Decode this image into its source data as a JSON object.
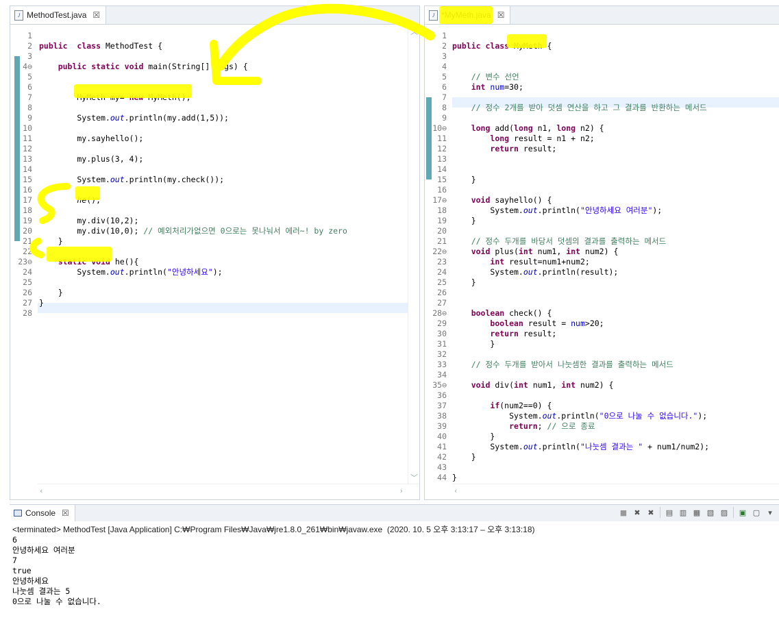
{
  "left_editor": {
    "tab_label": "MethodTest.java",
    "lines": [
      {
        "n": "1",
        "t": []
      },
      {
        "n": "2",
        "t": [
          [
            "kw",
            "public"
          ],
          [
            "",
            "  "
          ],
          [
            "kw",
            "class"
          ],
          [
            "",
            " MethodTest {"
          ]
        ]
      },
      {
        "n": "3",
        "t": []
      },
      {
        "n": "4⊖",
        "t": [
          [
            "",
            "    "
          ],
          [
            "kw",
            "public"
          ],
          [
            "",
            " "
          ],
          [
            "kw",
            "static"
          ],
          [
            "",
            " "
          ],
          [
            "kw",
            "void"
          ],
          [
            "",
            " main(String[] args) {"
          ]
        ]
      },
      {
        "n": "5",
        "t": []
      },
      {
        "n": "6",
        "t": []
      },
      {
        "n": "7",
        "t": [
          [
            "",
            "        MyMeth my= "
          ],
          [
            "kw",
            "new"
          ],
          [
            "",
            " MyMeth();"
          ]
        ]
      },
      {
        "n": "8",
        "t": []
      },
      {
        "n": "9",
        "t": [
          [
            "",
            "        System."
          ],
          [
            "fl",
            "out"
          ],
          [
            "",
            ".println(my.add(1,5));"
          ]
        ]
      },
      {
        "n": "10",
        "t": []
      },
      {
        "n": "11",
        "t": [
          [
            "",
            "        my.sayhello();"
          ]
        ]
      },
      {
        "n": "12",
        "t": []
      },
      {
        "n": "13",
        "t": [
          [
            "",
            "        my.plus(3, 4);"
          ]
        ]
      },
      {
        "n": "14",
        "t": []
      },
      {
        "n": "15",
        "t": [
          [
            "",
            "        System."
          ],
          [
            "fl",
            "out"
          ],
          [
            "",
            ".println(my.check());"
          ]
        ]
      },
      {
        "n": "16",
        "t": []
      },
      {
        "n": "17",
        "t": [
          [
            "",
            "        "
          ],
          [
            "it",
            "he"
          ],
          [
            "",
            "();"
          ]
        ]
      },
      {
        "n": "18",
        "t": []
      },
      {
        "n": "19",
        "t": [
          [
            "",
            "        my.div(10,2);"
          ]
        ]
      },
      {
        "n": "20",
        "t": [
          [
            "",
            "        my.div(10,0); "
          ],
          [
            "cm",
            "// 예외처리가없으면 0으로는 못나눠서 에러~! by zero"
          ]
        ]
      },
      {
        "n": "21",
        "t": [
          [
            "",
            "    }"
          ]
        ]
      },
      {
        "n": "22",
        "t": []
      },
      {
        "n": "23⊖",
        "t": [
          [
            "",
            "    "
          ],
          [
            "kw",
            "static"
          ],
          [
            "",
            " "
          ],
          [
            "kw",
            "void"
          ],
          [
            "",
            " he(){"
          ]
        ]
      },
      {
        "n": "24",
        "t": [
          [
            "",
            "        System."
          ],
          [
            "fl",
            "out"
          ],
          [
            "",
            ".println("
          ],
          [
            "st",
            "\"안녕하세요\""
          ],
          [
            "",
            ");"
          ]
        ]
      },
      {
        "n": "25",
        "t": []
      },
      {
        "n": "26",
        "t": [
          [
            "",
            "    }"
          ]
        ]
      },
      {
        "n": "27",
        "t": [
          [
            "",
            "}"
          ]
        ]
      },
      {
        "n": "28",
        "t": []
      }
    ]
  },
  "right_editor": {
    "tab_label": "*MyMeth.java",
    "lines": [
      {
        "n": "1",
        "t": []
      },
      {
        "n": "2",
        "t": [
          [
            "kw",
            "public"
          ],
          [
            "",
            " "
          ],
          [
            "kw",
            "class"
          ],
          [
            "",
            " MyMeth {"
          ]
        ]
      },
      {
        "n": "3",
        "t": []
      },
      {
        "n": "4",
        "t": []
      },
      {
        "n": "5",
        "t": [
          [
            "",
            "    "
          ],
          [
            "cm",
            "// 변수 선언"
          ]
        ]
      },
      {
        "n": "6",
        "t": [
          [
            "",
            "    "
          ],
          [
            "kw",
            "int"
          ],
          [
            "",
            " "
          ],
          [
            "fd",
            "num"
          ],
          [
            "",
            "=30;"
          ]
        ]
      },
      {
        "n": "7",
        "t": []
      },
      {
        "n": "8",
        "t": [
          [
            "",
            "    "
          ],
          [
            "cm",
            "// 정수 2개를 받아 덧셈 연산을 하고 그 결과를 반환하는 메서드"
          ]
        ]
      },
      {
        "n": "9",
        "t": []
      },
      {
        "n": "10⊖",
        "t": [
          [
            "",
            "    "
          ],
          [
            "kw",
            "long"
          ],
          [
            "",
            " add("
          ],
          [
            "kw",
            "long"
          ],
          [
            "",
            " n1, "
          ],
          [
            "kw",
            "long"
          ],
          [
            "",
            " n2) {"
          ]
        ]
      },
      {
        "n": "11",
        "t": [
          [
            "",
            "        "
          ],
          [
            "kw",
            "long"
          ],
          [
            "",
            " result = n1 + n2;"
          ]
        ]
      },
      {
        "n": "12",
        "t": [
          [
            "",
            "        "
          ],
          [
            "kw",
            "return"
          ],
          [
            "",
            " result;"
          ]
        ]
      },
      {
        "n": "13",
        "t": []
      },
      {
        "n": "14",
        "t": []
      },
      {
        "n": "15",
        "t": [
          [
            "",
            "    }"
          ]
        ]
      },
      {
        "n": "16",
        "t": []
      },
      {
        "n": "17⊖",
        "t": [
          [
            "",
            "    "
          ],
          [
            "kw",
            "void"
          ],
          [
            "",
            " sayhello() {"
          ]
        ]
      },
      {
        "n": "18",
        "t": [
          [
            "",
            "        System."
          ],
          [
            "fl",
            "out"
          ],
          [
            "",
            ".println("
          ],
          [
            "st",
            "\"안녕하세요 여러분\""
          ],
          [
            "",
            ");"
          ]
        ]
      },
      {
        "n": "19",
        "t": [
          [
            "",
            "    }"
          ]
        ]
      },
      {
        "n": "20",
        "t": []
      },
      {
        "n": "21",
        "t": [
          [
            "",
            "    "
          ],
          [
            "cm",
            "// 정수 두개를 바당서 덧셈의 결과를 출력하는 메서드"
          ]
        ]
      },
      {
        "n": "22⊖",
        "t": [
          [
            "",
            "    "
          ],
          [
            "kw",
            "void"
          ],
          [
            "",
            " plus("
          ],
          [
            "kw",
            "int"
          ],
          [
            "",
            " num1, "
          ],
          [
            "kw",
            "int"
          ],
          [
            "",
            " num2) {"
          ]
        ]
      },
      {
        "n": "23",
        "t": [
          [
            "",
            "        "
          ],
          [
            "kw",
            "int"
          ],
          [
            "",
            " result=num1+num2;"
          ]
        ]
      },
      {
        "n": "24",
        "t": [
          [
            "",
            "        System."
          ],
          [
            "fl",
            "out"
          ],
          [
            "",
            ".println(result);"
          ]
        ]
      },
      {
        "n": "25",
        "t": [
          [
            "",
            "    }"
          ]
        ]
      },
      {
        "n": "26",
        "t": []
      },
      {
        "n": "27",
        "t": []
      },
      {
        "n": "28⊖",
        "t": [
          [
            "",
            "    "
          ],
          [
            "kw",
            "boolean"
          ],
          [
            "",
            " check() {"
          ]
        ]
      },
      {
        "n": "29",
        "t": [
          [
            "",
            "        "
          ],
          [
            "kw",
            "boolean"
          ],
          [
            "",
            " result = "
          ],
          [
            "fd",
            "num"
          ],
          [
            "",
            ">20;"
          ]
        ]
      },
      {
        "n": "30",
        "t": [
          [
            "",
            "        "
          ],
          [
            "kw",
            "return"
          ],
          [
            "",
            " result;"
          ]
        ]
      },
      {
        "n": "31",
        "t": [
          [
            "",
            "        }"
          ]
        ]
      },
      {
        "n": "32",
        "t": []
      },
      {
        "n": "33",
        "t": [
          [
            "",
            "    "
          ],
          [
            "cm",
            "// 정수 두개를 받아서 나눗셈한 결과를 출력하는 메서드"
          ]
        ]
      },
      {
        "n": "34",
        "t": []
      },
      {
        "n": "35⊖",
        "t": [
          [
            "",
            "    "
          ],
          [
            "kw",
            "void"
          ],
          [
            "",
            " div("
          ],
          [
            "kw",
            "int"
          ],
          [
            "",
            " num1, "
          ],
          [
            "kw",
            "int"
          ],
          [
            "",
            " num2) {"
          ]
        ]
      },
      {
        "n": "36",
        "t": []
      },
      {
        "n": "37",
        "t": [
          [
            "",
            "        "
          ],
          [
            "kw",
            "if"
          ],
          [
            "",
            "(num2==0) {"
          ]
        ]
      },
      {
        "n": "38",
        "t": [
          [
            "",
            "            System."
          ],
          [
            "fl",
            "out"
          ],
          [
            "",
            ".println("
          ],
          [
            "st",
            "\"0으로 나눌 수 없습니다.\""
          ],
          [
            "",
            ");"
          ]
        ]
      },
      {
        "n": "39",
        "t": [
          [
            "",
            "            "
          ],
          [
            "kw",
            "return"
          ],
          [
            "",
            "; "
          ],
          [
            "cm",
            "// 으로 종료"
          ]
        ]
      },
      {
        "n": "40",
        "t": [
          [
            "",
            "        }"
          ]
        ]
      },
      {
        "n": "41",
        "t": [
          [
            "",
            "        System."
          ],
          [
            "fl",
            "out"
          ],
          [
            "",
            ".println("
          ],
          [
            "st",
            "\"나눗셈 결과는 \""
          ],
          [
            "",
            " + num1/num2);"
          ]
        ]
      },
      {
        "n": "42",
        "t": [
          [
            "",
            "    }"
          ]
        ]
      },
      {
        "n": "43",
        "t": []
      },
      {
        "n": "44",
        "t": [
          [
            "",
            "}"
          ]
        ]
      }
    ]
  },
  "console": {
    "tab_label": "Console",
    "status": "<terminated> MethodTest [Java Application] C:₩Program Files₩Java₩jre1.8.0_261₩bin₩javaw.exe  (2020. 10. 5 오후 3:13:17 – 오후 3:13:18)",
    "output": [
      "6",
      "안녕하세요 여러분",
      "7",
      "true",
      "안녕하세요",
      "나눗셈 결과는 5",
      "0으로 나눌 수 없습니다."
    ],
    "toolbar_icons": [
      "terminate-icon",
      "remove-launch-icon",
      "remove-all-icon",
      "clear-console-icon",
      "scroll-lock-icon",
      "word-wrap-icon",
      "pin-console-icon",
      "display-console-icon",
      "new-console-icon",
      "open-console-icon",
      "view-menu-icon"
    ]
  },
  "colors": {
    "highlight_yellow": "#ffff00",
    "keyword": "#7f0055",
    "comment": "#3f7f5f",
    "string": "#2a00ff",
    "field": "#0000c0",
    "change_bar": "#5fa8b4"
  }
}
